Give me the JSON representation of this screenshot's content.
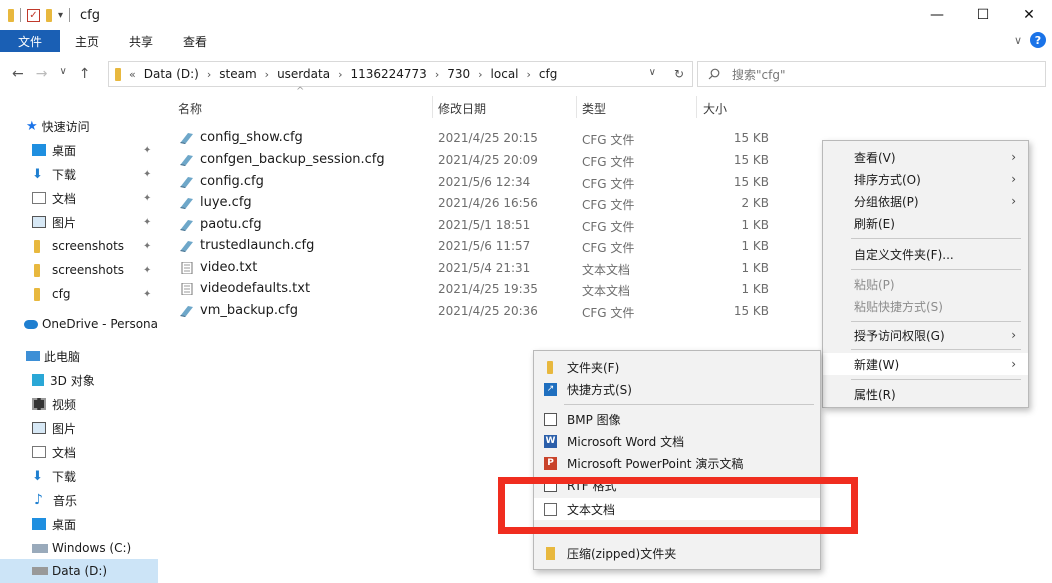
{
  "window": {
    "title": "cfg",
    "minimize": "—",
    "maximize": "☐",
    "close": "✕"
  },
  "ribbon": {
    "tabs": [
      "文件",
      "主页",
      "共享",
      "查看"
    ],
    "expand": "∨",
    "help": "?"
  },
  "address": {
    "back": "←",
    "forward": "→",
    "dropdown": "∨",
    "up": "↑",
    "overflow": "«",
    "segments": [
      "Data (D:)",
      "steam",
      "userdata",
      "1136224773",
      "730",
      "local",
      "cfg"
    ],
    "refresh": "↻",
    "search_placeholder": "搜索\"cfg\"",
    "sep": "›"
  },
  "sidebar": {
    "items": [
      {
        "label": "快速访问",
        "pinned": false
      },
      {
        "label": "桌面",
        "pinned": true
      },
      {
        "label": "下载",
        "pinned": true
      },
      {
        "label": "文档",
        "pinned": true
      },
      {
        "label": "图片",
        "pinned": true
      },
      {
        "label": "screenshots",
        "pinned": true
      },
      {
        "label": "screenshots",
        "pinned": true
      },
      {
        "label": "cfg",
        "pinned": true
      },
      {
        "label": "OneDrive - Persona",
        "pinned": false
      },
      {
        "label": "此电脑",
        "pinned": false
      },
      {
        "label": "3D 对象",
        "pinned": false
      },
      {
        "label": "视频",
        "pinned": false
      },
      {
        "label": "图片",
        "pinned": false
      },
      {
        "label": "文档",
        "pinned": false
      },
      {
        "label": "下载",
        "pinned": false
      },
      {
        "label": "音乐",
        "pinned": false
      },
      {
        "label": "桌面",
        "pinned": false
      },
      {
        "label": "Windows (C:)",
        "pinned": false
      },
      {
        "label": "Data (D:)",
        "pinned": false
      }
    ],
    "pin_glyph": "✦"
  },
  "columns": {
    "sort_glyph": "^",
    "name": "名称",
    "date": "修改日期",
    "type": "类型",
    "size": "大小"
  },
  "files": [
    {
      "name": "config_show.cfg",
      "date": "2021/4/25 20:15",
      "type": "CFG 文件",
      "size": "15 KB",
      "kind": "cfg"
    },
    {
      "name": "confgen_backup_session.cfg",
      "date": "2021/4/25 20:09",
      "type": "CFG 文件",
      "size": "15 KB",
      "kind": "cfg"
    },
    {
      "name": "config.cfg",
      "date": "2021/5/6 12:34",
      "type": "CFG 文件",
      "size": "15 KB",
      "kind": "cfg"
    },
    {
      "name": "luye.cfg",
      "date": "2021/4/26 16:56",
      "type": "CFG 文件",
      "size": "2 KB",
      "kind": "cfg"
    },
    {
      "name": "paotu.cfg",
      "date": "2021/5/1 18:51",
      "type": "CFG 文件",
      "size": "1 KB",
      "kind": "cfg"
    },
    {
      "name": "trustedlaunch.cfg",
      "date": "2021/5/6 11:57",
      "type": "CFG 文件",
      "size": "1 KB",
      "kind": "cfg"
    },
    {
      "name": "video.txt",
      "date": "2021/5/4 21:31",
      "type": "文本文档",
      "size": "1 KB",
      "kind": "txt"
    },
    {
      "name": "videodefaults.txt",
      "date": "2021/4/25 19:35",
      "type": "文本文档",
      "size": "1 KB",
      "kind": "txt"
    },
    {
      "name": "vm_backup.cfg",
      "date": "2021/4/25 20:36",
      "type": "CFG 文件",
      "size": "15 KB",
      "kind": "cfg"
    }
  ],
  "context_menu": {
    "items": [
      {
        "label": "查看(V)",
        "submenu": true,
        "disabled": false
      },
      {
        "label": "排序方式(O)",
        "submenu": true,
        "disabled": false
      },
      {
        "label": "分组依据(P)",
        "submenu": true,
        "disabled": false
      },
      {
        "label": "刷新(E)",
        "submenu": false,
        "disabled": false
      },
      {
        "label": "自定义文件夹(F)...",
        "submenu": false,
        "disabled": false
      },
      {
        "label": "粘贴(P)",
        "submenu": false,
        "disabled": true
      },
      {
        "label": "粘贴快捷方式(S)",
        "submenu": false,
        "disabled": true
      },
      {
        "label": "授予访问权限(G)",
        "submenu": true,
        "disabled": false
      },
      {
        "label": "新建(W)",
        "submenu": true,
        "disabled": false
      },
      {
        "label": "属性(R)",
        "submenu": false,
        "disabled": false
      }
    ],
    "arrow": "›"
  },
  "new_submenu": {
    "items": [
      {
        "label": "文件夹(F)"
      },
      {
        "label": "快捷方式(S)"
      },
      {
        "label": "BMP 图像"
      },
      {
        "label": "Microsoft Word 文档"
      },
      {
        "label": "Microsoft PowerPoint 演示文稿"
      },
      {
        "label": "RTF 格式"
      },
      {
        "label": "文本文档"
      },
      {
        "label": "压缩(zipped)文件夹"
      }
    ]
  },
  "colors": {
    "accent": "#1a5fb4",
    "highlight_box": "#f02d1f",
    "selection": "#cce4f7"
  }
}
